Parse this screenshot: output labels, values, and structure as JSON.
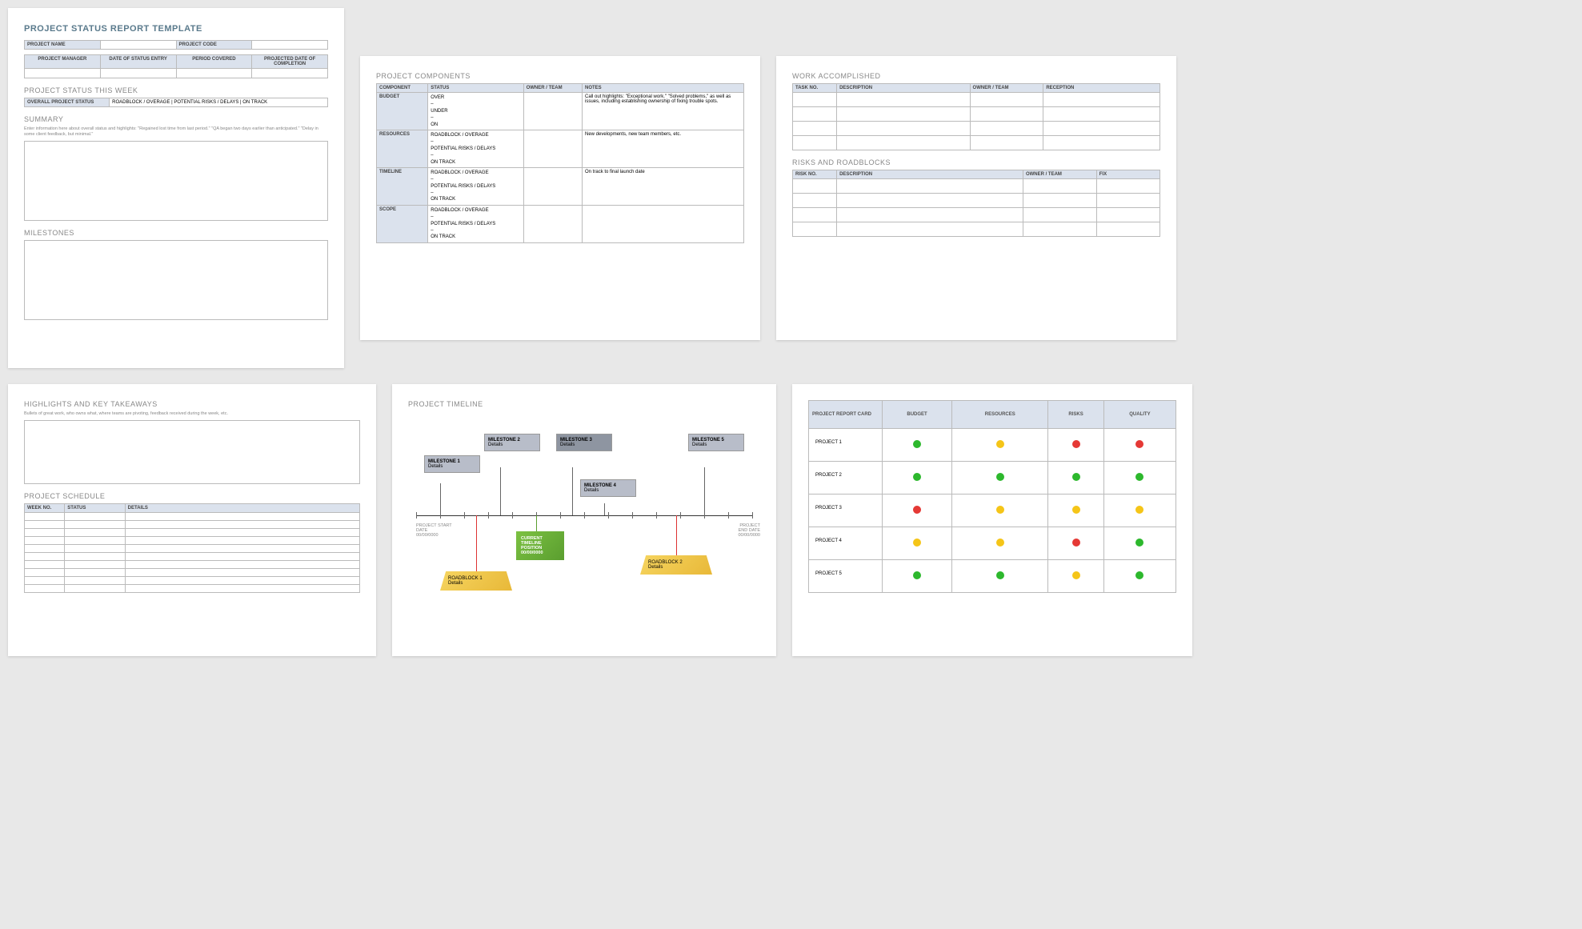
{
  "page1": {
    "title": "PROJECT STATUS REPORT TEMPLATE",
    "meta1": {
      "projectName": "PROJECT NAME",
      "projectCode": "PROJECT CODE"
    },
    "meta2": {
      "pm": "PROJECT MANAGER",
      "dse": "DATE OF STATUS ENTRY",
      "pc": "PERIOD COVERED",
      "pdc": "PROJECTED DATE OF COMPLETION"
    },
    "statusWeek": "PROJECT STATUS THIS WEEK",
    "statusRow": {
      "h": "OVERALL PROJECT STATUS",
      "opts": "ROADBLOCK / OVERAGE   |   POTENTIAL RISKS / DELAYS   |   ON TRACK"
    },
    "summary": "SUMMARY",
    "summaryNote": "Enter information here about overall status and highlights: \"Regained lost time from last period.\" \"QA began two days earlier than anticipated.\" \"Delay in some client feedback, but minimal.\"",
    "milestones": "MILESTONES"
  },
  "page2": {
    "title": "PROJECT COMPONENTS",
    "headers": {
      "c": "COMPONENT",
      "s": "STATUS",
      "o": "OWNER / TEAM",
      "n": "NOTES"
    },
    "rows": [
      {
        "c": "BUDGET",
        "s": "OVER\n–\nUNDER\n–\nON",
        "n": "Call out highlights: \"Exceptional work.\" \"Solved problems,\" as well as issues, including establishing ownership of fixing trouble spots."
      },
      {
        "c": "RESOURCES",
        "s": "ROADBLOCK / OVERAGE\n–\nPOTENTIAL RISKS / DELAYS\n–\nON TRACK",
        "n": "New developments, new team members, etc."
      },
      {
        "c": "TIMELINE",
        "s": "ROADBLOCK / OVERAGE\n–\nPOTENTIAL RISKS / DELAYS\n–\nON TRACK",
        "n": "On track to final launch date"
      },
      {
        "c": "SCOPE",
        "s": "ROADBLOCK / OVERAGE\n–\nPOTENTIAL RISKS / DELAYS\n–\nON TRACK",
        "n": ""
      }
    ]
  },
  "page3": {
    "work": {
      "title": "WORK ACCOMPLISHED",
      "h": {
        "t": "TASK NO.",
        "d": "DESCRIPTION",
        "o": "OWNER / TEAM",
        "r": "RECEPTION"
      }
    },
    "risks": {
      "title": "RISKS AND ROADBLOCKS",
      "h": {
        "t": "RISK NO.",
        "d": "DESCRIPTION",
        "o": "OWNER / TEAM",
        "f": "FIX"
      }
    }
  },
  "page4": {
    "hl": "HIGHLIGHTS AND KEY TAKEAWAYS",
    "hlNote": "Bullets of great work, who owns what, where teams are pivoting, feedback received during the week, etc.",
    "sched": "PROJECT SCHEDULE",
    "schedH": {
      "w": "WEEK NO.",
      "s": "STATUS",
      "d": "DETAILS"
    }
  },
  "page5": {
    "title": "PROJECT TIMELINE",
    "start": {
      "l1": "PROJECT START",
      "l2": "DATE",
      "l3": "00/00/0000"
    },
    "end": {
      "l1": "PROJECT",
      "l2": "END DATE",
      "l3": "00/00/0000"
    },
    "ms": [
      {
        "t": "MILESTONE 1",
        "d": "Details"
      },
      {
        "t": "MILESTONE 2",
        "d": "Details"
      },
      {
        "t": "MILESTONE 3",
        "d": "Details"
      },
      {
        "t": "MILESTONE 4",
        "d": "Details"
      },
      {
        "t": "MILESTONE 5",
        "d": "Details"
      }
    ],
    "rb": [
      {
        "t": "ROADBLOCK 1",
        "d": "Details"
      },
      {
        "t": "ROADBLOCK 2",
        "d": "Details"
      }
    ],
    "pos": {
      "l1": "CURRENT",
      "l2": "TIMELINE",
      "l3": "POSITION",
      "l4": "00/00/0000"
    }
  },
  "page6": {
    "h": {
      "p": "PROJECT REPORT CARD",
      "b": "BUDGET",
      "r": "RESOURCES",
      "ri": "RISKS",
      "q": "QUALITY"
    },
    "rows": [
      {
        "p": "PROJECT 1",
        "v": [
          "g",
          "y",
          "r",
          "r"
        ]
      },
      {
        "p": "PROJECT 2",
        "v": [
          "g",
          "g",
          "g",
          "g"
        ]
      },
      {
        "p": "PROJECT 3",
        "v": [
          "r",
          "y",
          "y",
          "y"
        ]
      },
      {
        "p": "PROJECT 4",
        "v": [
          "y",
          "y",
          "r",
          "g"
        ]
      },
      {
        "p": "PROJECT 5",
        "v": [
          "g",
          "g",
          "y",
          "g"
        ]
      }
    ]
  }
}
